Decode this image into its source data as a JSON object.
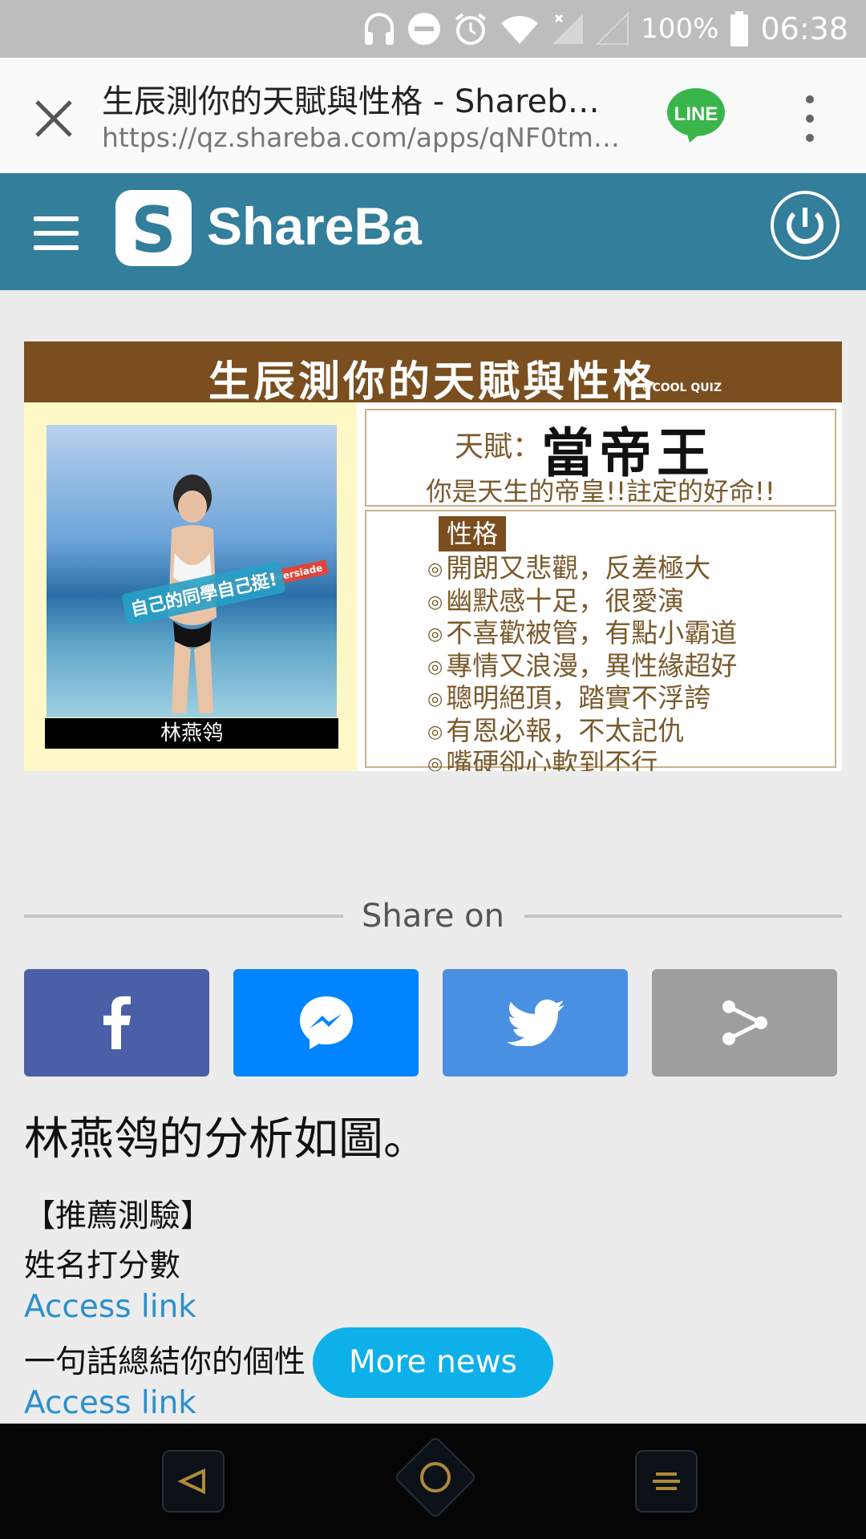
{
  "status_bar": {
    "battery": "100%",
    "time": "06:38"
  },
  "browser": {
    "title": "生辰測你的天賦與性格 - Shareba…",
    "url": "https://qz.shareba.com/apps/qNF0tmG…"
  },
  "site": {
    "logo_letter": "S",
    "logo_name": "ShareBa"
  },
  "result": {
    "banner_title": "生辰測你的天賦與性格",
    "brand": "©COOL QUIZ",
    "photo_text": "自己的同學自己挺!",
    "photo_tag": "Taipei 2017 Universiade",
    "photo_caption": "林燕鸰",
    "talent_label": "天賦：",
    "talent_value": "當帝王",
    "talent_desc": "你是天生的帝皇!!註定的好命!!",
    "trait_head": "性格",
    "traits": [
      "開朗又悲觀，反差極大",
      "幽默感十足，很愛演",
      "不喜歡被管，有點小霸道",
      "專情又浪漫，異性緣超好",
      "聰明絕頂，踏實不浮誇",
      "有恩必報，不太記仇",
      "嘴硬卻心軟到不行"
    ]
  },
  "share": {
    "label": "Share on",
    "buttons": [
      {
        "name": "facebook",
        "color": "#4a5fa8"
      },
      {
        "name": "messenger",
        "color": "#0084ff"
      },
      {
        "name": "twitter",
        "color": "#4a90e2"
      },
      {
        "name": "share",
        "color": "#9e9e9e"
      }
    ]
  },
  "content": {
    "analysis": "林燕鸰的分析如圖。",
    "rec_head": "【推薦測驗】",
    "rec1": "姓名打分數",
    "link1": "Access link",
    "rec2": "一句話總結你的個性",
    "link2": "Access link"
  },
  "more_news": "More news",
  "colors": {
    "header": "#327e9b",
    "accent": "#0eb0ea",
    "line_green": "#3ab54a"
  }
}
